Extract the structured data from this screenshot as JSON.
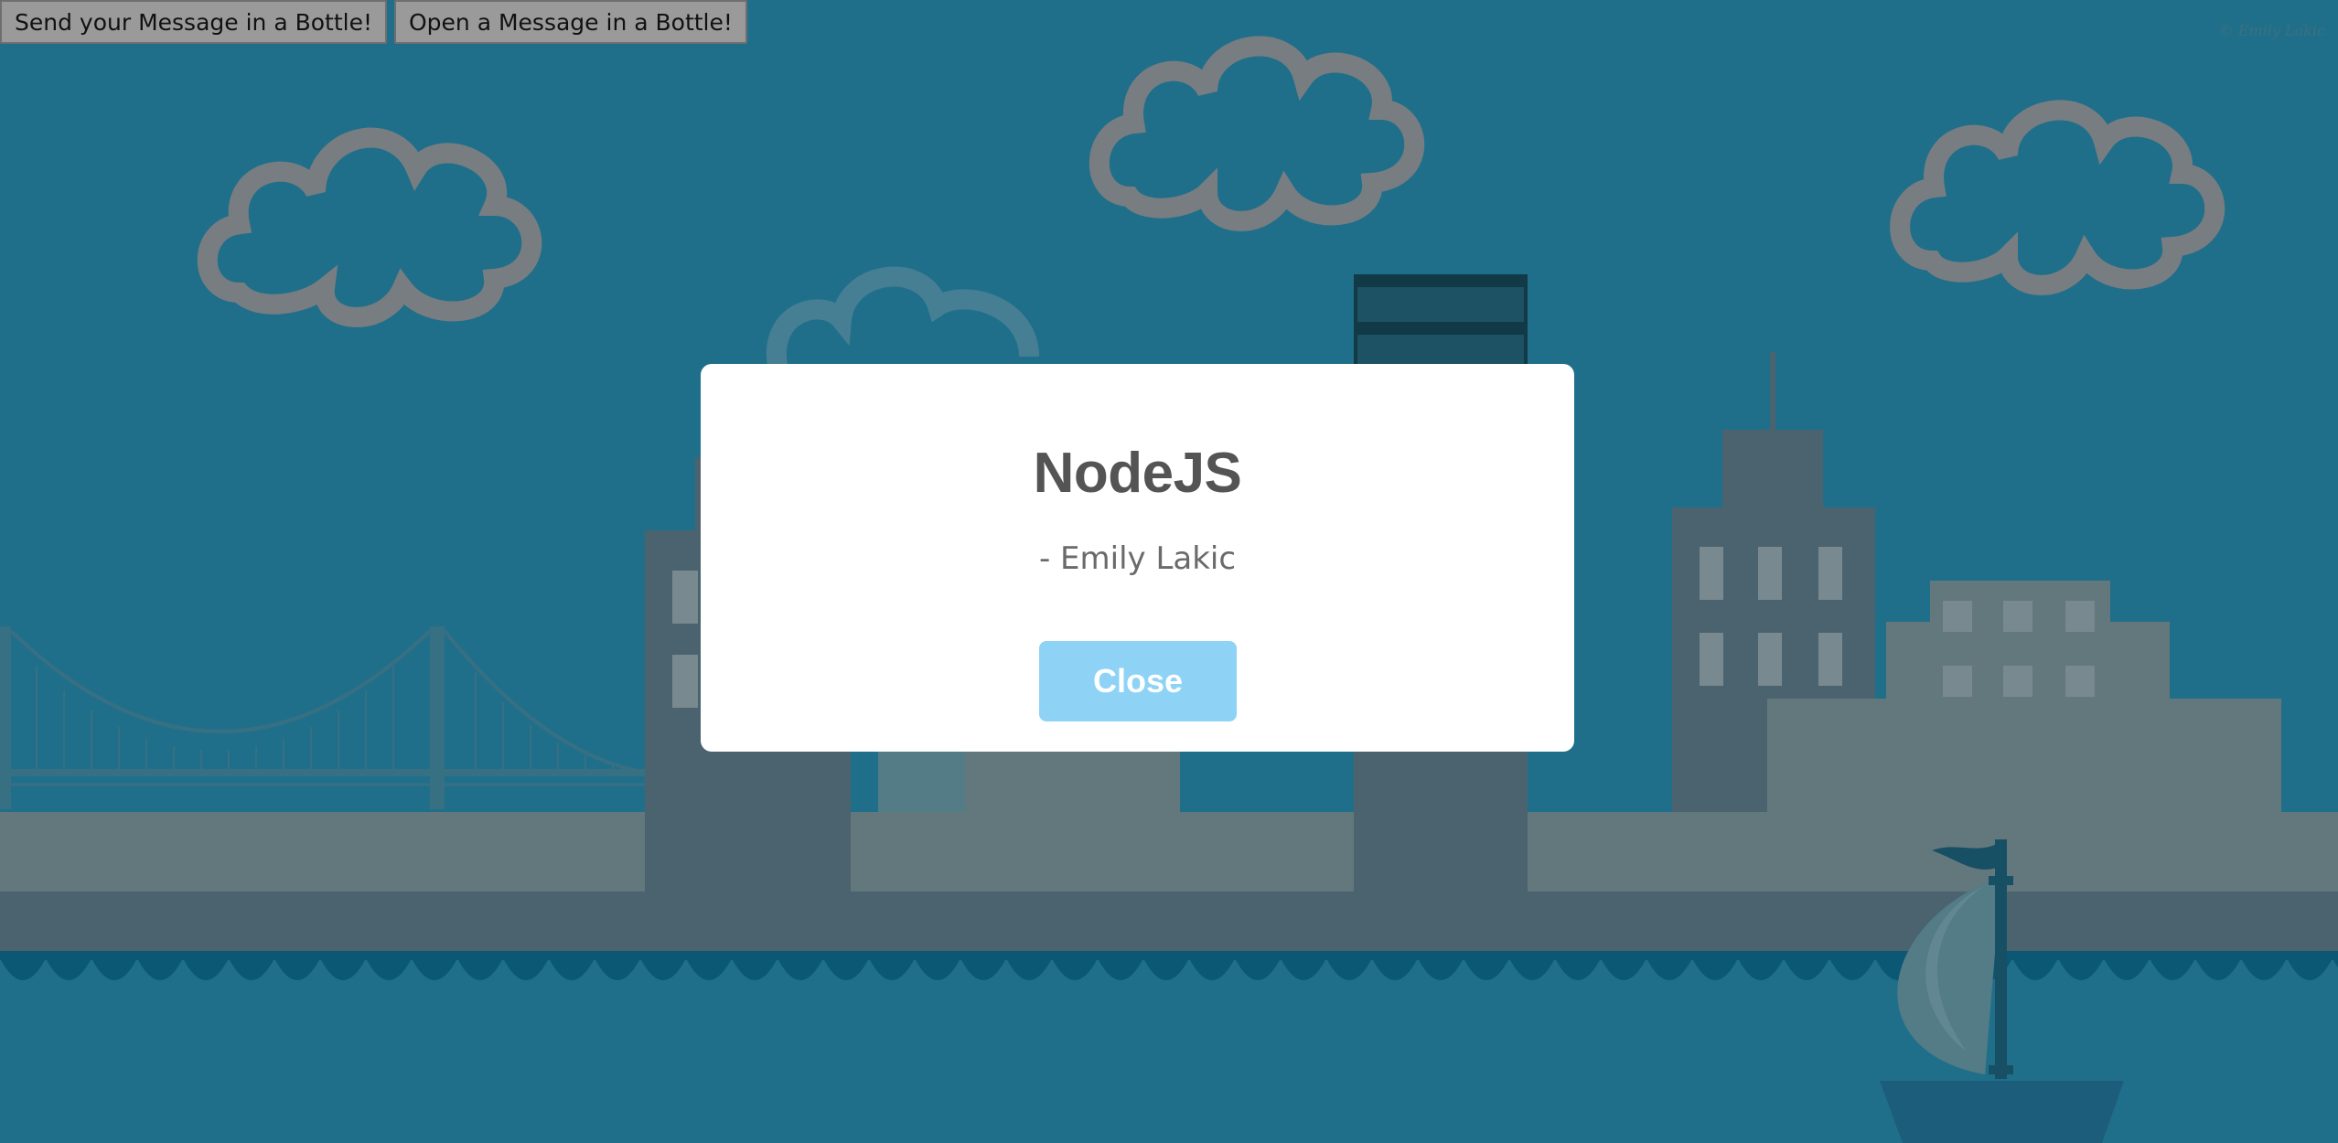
{
  "toolbar": {
    "send_label": "Send your Message in a Bottle!",
    "open_label": "Open a Message in a Bottle!"
  },
  "copyright": "© Emily Lakic",
  "modal": {
    "title": "NodeJS",
    "author": "- Emily Lakic",
    "close_label": "Close"
  },
  "colors": {
    "sky": "#207a96",
    "cloud_outline": "#8c8c8c",
    "ground": "#728585",
    "building_dark": "#546c74",
    "water": "#207a96",
    "wave": "#065f7a",
    "close_button": "#8ed3f5"
  }
}
